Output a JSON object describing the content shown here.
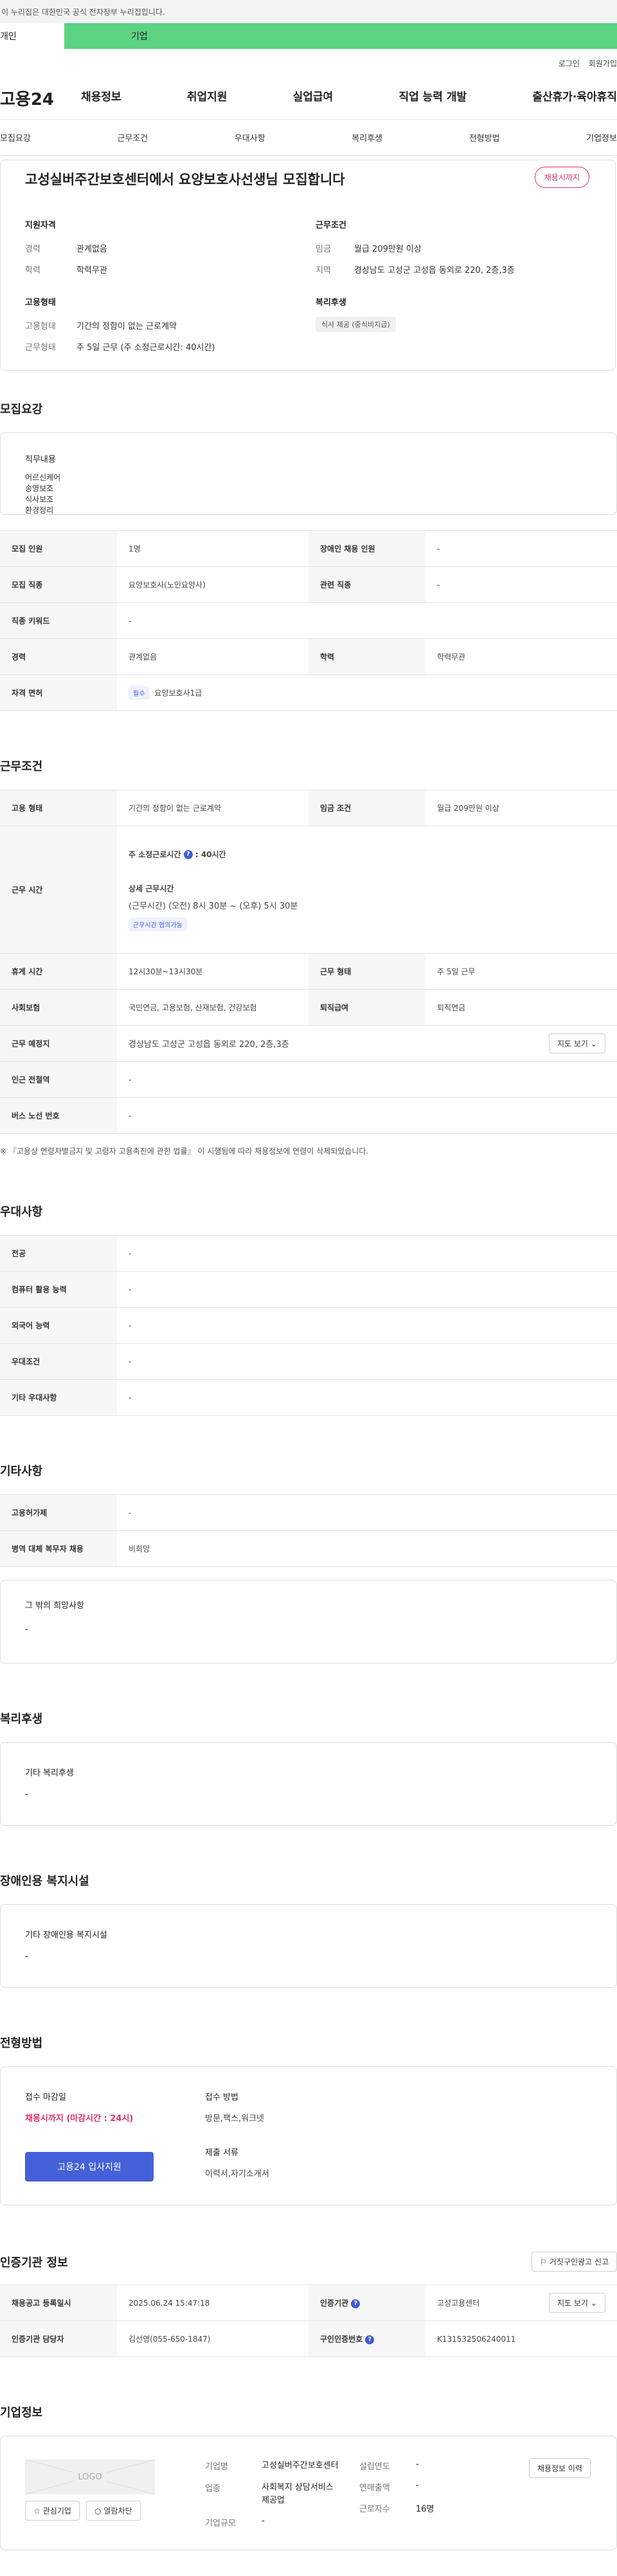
{
  "gov_banner": "이 누리집은 대한민국 공식 전자정부 누리집입니다.",
  "user_tabs": [
    "개인",
    "기업"
  ],
  "header": {
    "logo": "고용24",
    "top_links": [
      "로그인",
      "회원가입"
    ],
    "gnb": [
      "채용정보",
      "취업지원",
      "실업급여",
      "직업 능력 개발",
      "출산휴가·육아휴직"
    ]
  },
  "subtabs": [
    "모집요강",
    "근무조건",
    "우대사항",
    "복리후생",
    "전형방법",
    "기업정보"
  ],
  "summary": {
    "title": "고성실버주간보호센터에서 요양보호사선생님 모집합니다",
    "deadline_badge": "채용시까지",
    "qual_heading": "지원자격",
    "qual": [
      {
        "k": "경력",
        "v": "관계없음"
      },
      {
        "k": "학력",
        "v": "학력무관"
      }
    ],
    "cond_heading": "근무조건",
    "cond": [
      {
        "k": "임금",
        "v": "월급 209만원 이상"
      },
      {
        "k": "지역",
        "v": "경상남도 고성군 고성읍 동외로 220, 2층,3층"
      }
    ],
    "type_heading": "고용형태",
    "type": [
      {
        "k": "고용형태",
        "v": "기간의 정함이 없는 근로계약"
      },
      {
        "k": "근무형태",
        "v": "주 5일 근무 (주 소정근로시간: 40시간)"
      }
    ],
    "welfare_heading": "복리후생",
    "welfare_chip": "식사 제공 (중식비지급)"
  },
  "recruit": {
    "title": "모집요강",
    "duty_heading": "직무내용",
    "duties": [
      "어르신케어",
      "송영보조",
      "식사보조",
      "환경정리"
    ],
    "rows": {
      "r1": [
        "모집 인원",
        "1명",
        "장애인 채용 인원",
        "-"
      ],
      "r2": [
        "모집 직종",
        "요양보호사(노인요양사)",
        "관련 직종",
        "-"
      ],
      "r3": [
        "직종 키워드",
        "-"
      ],
      "r4": [
        "경력",
        "관계없음",
        "학력",
        "학력무관"
      ],
      "r5_label": "자격 면허",
      "r5_tag": "필수",
      "r5_value": "요양보호사1급"
    }
  },
  "workcond": {
    "title": "근무조건",
    "r1": [
      "고용 형태",
      "기간의 정함이 없는 근로계약",
      "임금 조건",
      "월급 209만원 이상"
    ],
    "hours_label": "근무 시간",
    "hours_main": "주 소정근로시간",
    "hours_main_value": ": 40시간",
    "hours_detail_title": "상세 근무시간",
    "hours_detail": "(근무시간) (오전) 8시 30분 ~ (오후) 5시 30분",
    "hours_tag": "근무시간 협의가능",
    "r3": [
      "휴게 시간",
      "12시30분~13시30분",
      "근무 형태",
      "주 5일 근무"
    ],
    "r4": [
      "사회보험",
      "국민연금, 고용보험, 산재보험, 건강보험",
      "퇴직급여",
      "퇴직연금"
    ],
    "loc_label": "근무 예정지",
    "loc_value": "경상남도 고성군 고성읍 동외로 220, 2층,3층",
    "map_btn": "지도 보기",
    "r6": [
      "인근 전철역",
      "-"
    ],
    "r7": [
      "버스 노선 번호",
      "-"
    ],
    "note": "※ 『고용상 연령차별금지 및 고령자 고용촉진에 관한 법률』 이 시행됨에 따라 채용정보에 연령이 삭제되었습니다."
  },
  "pref": {
    "title": "우대사항",
    "rows": [
      [
        "전공",
        "-"
      ],
      [
        "컴퓨터 활용 능력",
        "-"
      ],
      [
        "외국어 능력",
        "-"
      ],
      [
        "우대조건",
        "-"
      ],
      [
        "기타 우대사항",
        "-"
      ]
    ]
  },
  "etc": {
    "title": "기타사항",
    "rows": [
      [
        "고용허가제",
        "-"
      ],
      [
        "병역 대체 복무자 채용",
        "비희망"
      ]
    ],
    "box_heading": "그 밖의 희망사항",
    "box_value": "-"
  },
  "welfare": {
    "title": "복리후생",
    "heading": "기타 복리후생",
    "value": "-"
  },
  "disability": {
    "title": "장애인용 복지시설",
    "heading": "기타 장애인용 복지시설",
    "value": "-"
  },
  "process": {
    "title": "전형방법",
    "deadline_heading": "접수 마감일",
    "deadline_value": "채용시까지 (마감시간 : 24시)",
    "apply_button": "고용24 입사지원",
    "method_heading": "접수 방법",
    "method_value": "방문,팩스,워크넷",
    "docs_heading": "제출 서류",
    "docs_value": "이력서,자기소개서"
  },
  "agency": {
    "title": "인증기관 정보",
    "report_btn": "거짓구인광고 신고",
    "r1": [
      "채용공고 등록일시",
      "2025.06.24 15:47:18",
      "인증기관",
      "고성고용센터"
    ],
    "r2": [
      "인증기관 담당자",
      "김선영(055-650-1847)",
      "구인인증번호",
      "K131532506240011"
    ],
    "map_btn": "지도 보기"
  },
  "company": {
    "title": "기업정보",
    "logo_text": "LOGO",
    "fav_btn": "관심기업",
    "block_btn": "열람차단",
    "fields": [
      [
        "기업명",
        "고성실버주간보호센터"
      ],
      [
        "업종",
        "사회복지 상담서비스 제공업"
      ],
      [
        "기업규모",
        "-"
      ]
    ],
    "fields2": [
      [
        "설립연도",
        "-"
      ],
      [
        "연매출액",
        "-"
      ],
      [
        "근로자수",
        "16명"
      ]
    ],
    "history_btn": "채용정보 이력"
  }
}
